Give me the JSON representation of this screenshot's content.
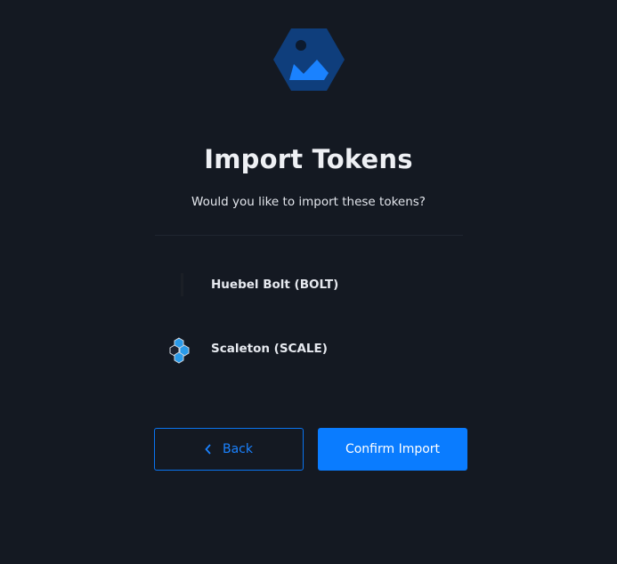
{
  "logo": {
    "icon": "image-hexagon-icon",
    "colors": {
      "hex": "#0f3e7c",
      "mountain": "#1a82ff",
      "sun": "#0c1a2e"
    }
  },
  "header": {
    "title": "Import Tokens",
    "subtitle": "Would you like to import these tokens?"
  },
  "tokens": [
    {
      "label": "Huebel Bolt (BOLT)",
      "icon": "bolt-token-icon"
    },
    {
      "label": "Scaleton (SCALE)",
      "icon": "scaleton-hexagons-icon"
    }
  ],
  "actions": {
    "back_label": "Back",
    "confirm_label": "Confirm Import"
  },
  "colors": {
    "background": "#141922",
    "accent": "#0a7cff"
  }
}
